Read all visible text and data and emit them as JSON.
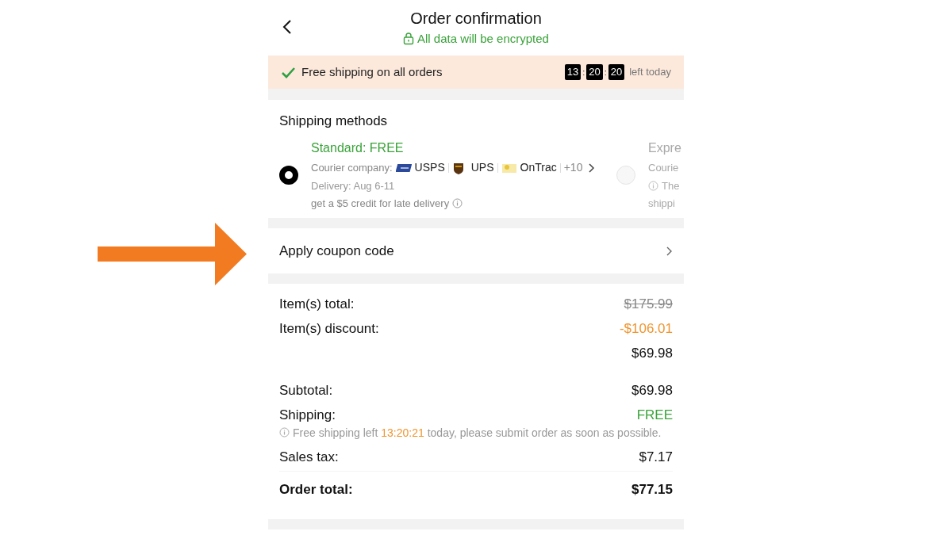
{
  "header": {
    "title": "Order confirmation",
    "subtitle": "All data will be encrypted"
  },
  "banner": {
    "text": "Free shipping on all orders",
    "timer": [
      "13",
      "20",
      "20"
    ],
    "separator": ":",
    "suffix": "left today"
  },
  "shipping": {
    "title": "Shipping methods",
    "options": [
      {
        "selected": true,
        "name": "Standard: FREE",
        "courier_label": "Courier company:",
        "couriers": [
          "USPS",
          "UPS",
          "OnTrac"
        ],
        "more": "+10",
        "delivery": "Delivery: Aug 6-11",
        "note": "get a $5 credit for late delivery"
      },
      {
        "selected": false,
        "name": "Expre",
        "courier_label": "Courie",
        "note": "The",
        "note_2": "shippi"
      }
    ]
  },
  "coupon": {
    "label": "Apply coupon code"
  },
  "summary": [
    {
      "kind": "strike",
      "label": "Item(s) total:",
      "value": "$175.99"
    },
    {
      "kind": "discount",
      "label": "Item(s) discount:",
      "value": "-$106.01"
    },
    {
      "kind": "plain",
      "value": "$69.98"
    },
    {
      "kind": "gap"
    },
    {
      "kind": "plain",
      "label": "Subtotal:",
      "value": "$69.98"
    },
    {
      "kind": "free",
      "label": "Shipping:",
      "value": "FREE"
    },
    {
      "kind": "note",
      "before": "Free shipping left",
      "time": "13:20:21",
      "after": "today, please submit order as soon as possible."
    },
    {
      "kind": "plain",
      "label": "Sales tax:",
      "value": "$7.17"
    },
    {
      "kind": "total",
      "label": "Order total:",
      "value": "$77.15"
    }
  ]
}
